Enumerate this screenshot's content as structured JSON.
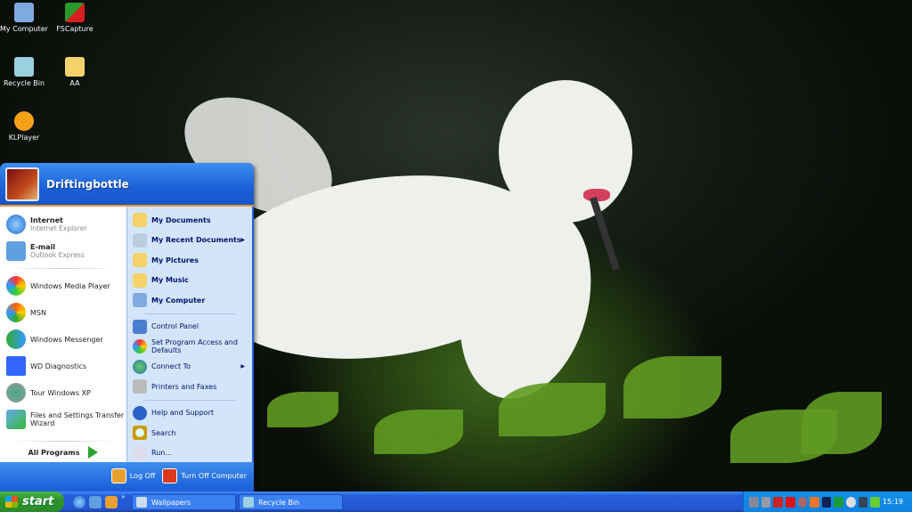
{
  "desktop": {
    "icons": [
      {
        "label": "My Computer"
      },
      {
        "label": "FSCapture"
      },
      {
        "label": "Recycle Bin"
      },
      {
        "label": "AA"
      },
      {
        "label": "KLPlayer"
      }
    ]
  },
  "start_menu": {
    "user": "Driftingbottle",
    "pinned": [
      {
        "title": "Internet",
        "sub": "Internet Explorer"
      },
      {
        "title": "E-mail",
        "sub": "Outlook Express"
      }
    ],
    "recent": [
      "Windows Media Player",
      "MSN",
      "Windows Messenger",
      "WD Diagnostics",
      "Tour Windows XP",
      "Files and Settings Transfer Wizard"
    ],
    "all_programs": "All Programs",
    "places": [
      "My Documents",
      "My Recent Documents",
      "My Pictures",
      "My Music",
      "My Computer"
    ],
    "settings": [
      "Control Panel",
      "Set Program Access and Defaults",
      "Connect To",
      "Printers and Faxes"
    ],
    "help": [
      "Help and Support",
      "Search",
      "Run..."
    ],
    "log_off": "Log Off",
    "turn_off": "Turn Off Computer"
  },
  "taskbar": {
    "start": "start",
    "quicklaunch_more": "»",
    "tasks": [
      "Wallpapers",
      "Recycle Bin"
    ],
    "clock": "15:19"
  }
}
